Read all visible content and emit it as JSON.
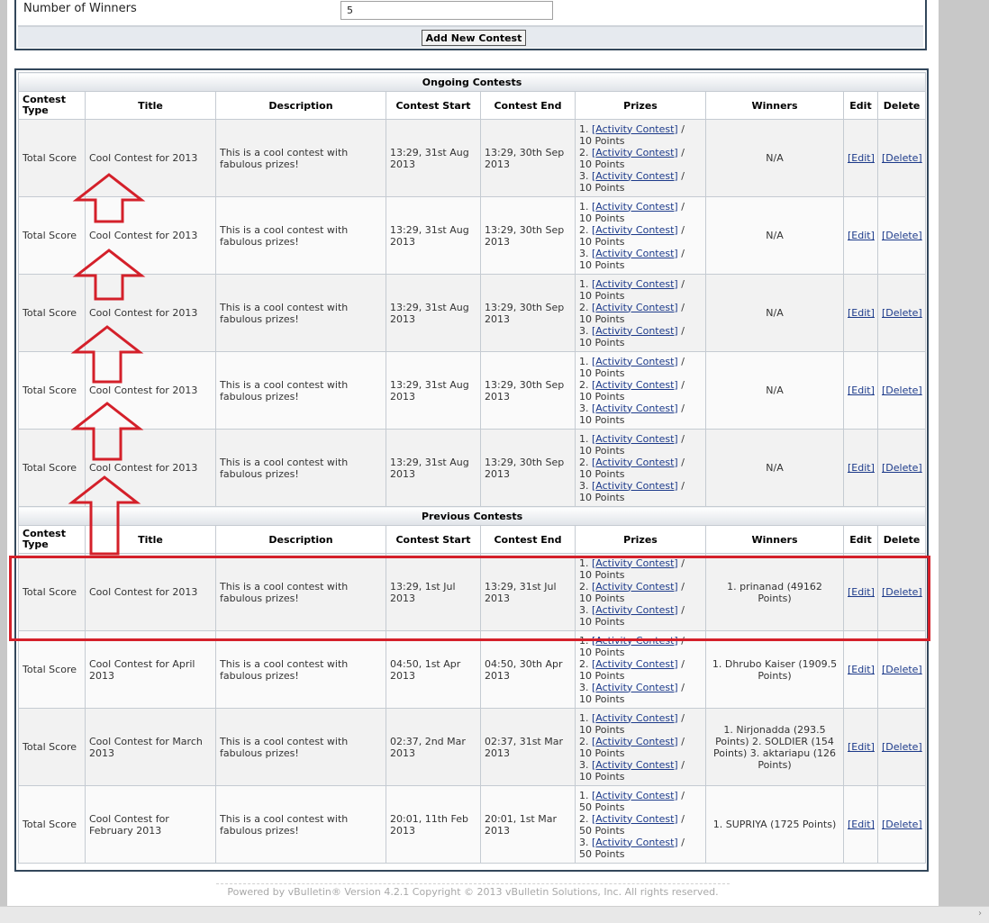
{
  "form": {
    "winners_label": "Number of Winners",
    "winners_value": "5",
    "add_button": "Add New Contest"
  },
  "sections": {
    "ongoing": "Ongoing Contests",
    "previous": "Previous Contests"
  },
  "columns": {
    "type": "Contest Type",
    "title": "Title",
    "description": "Description",
    "start": "Contest Start",
    "end": "Contest End",
    "prizes": "Prizes",
    "winners": "Winners",
    "edit": "Edit",
    "delete": "Delete"
  },
  "actions": {
    "edit": "[Edit]",
    "delete": "[Delete]"
  },
  "ongoing": [
    {
      "type": "Total Score",
      "title": "Cool Contest for 2013",
      "description": "This is a cool contest with fabulous prizes!",
      "start": "13:29, 31st Aug 2013",
      "end": "13:29, 30th Sep 2013",
      "winners": "N/A",
      "prizes": [
        {
          "n": "1.",
          "link": "[Activity Contest]",
          "pts": "10 Points"
        },
        {
          "n": "2.",
          "link": "[Activity Contest]",
          "pts": "10 Points"
        },
        {
          "n": "3.",
          "link": "[Activity Contest]",
          "pts": "10 Points"
        }
      ]
    },
    {
      "type": "Total Score",
      "title": "Cool Contest for 2013",
      "description": "This is a cool contest with fabulous prizes!",
      "start": "13:29, 31st Aug 2013",
      "end": "13:29, 30th Sep 2013",
      "winners": "N/A",
      "prizes": [
        {
          "n": "1.",
          "link": "[Activity Contest]",
          "pts": "10 Points"
        },
        {
          "n": "2.",
          "link": "[Activity Contest]",
          "pts": "10 Points"
        },
        {
          "n": "3.",
          "link": "[Activity Contest]",
          "pts": "10 Points"
        }
      ]
    },
    {
      "type": "Total Score",
      "title": "Cool Contest for 2013",
      "description": "This is a cool contest with fabulous prizes!",
      "start": "13:29, 31st Aug 2013",
      "end": "13:29, 30th Sep 2013",
      "winners": "N/A",
      "prizes": [
        {
          "n": "1.",
          "link": "[Activity Contest]",
          "pts": "10 Points"
        },
        {
          "n": "2.",
          "link": "[Activity Contest]",
          "pts": "10 Points"
        },
        {
          "n": "3.",
          "link": "[Activity Contest]",
          "pts": "10 Points"
        }
      ]
    },
    {
      "type": "Total Score",
      "title": "Cool Contest for 2013",
      "description": "This is a cool contest with fabulous prizes!",
      "start": "13:29, 31st Aug 2013",
      "end": "13:29, 30th Sep 2013",
      "winners": "N/A",
      "prizes": [
        {
          "n": "1.",
          "link": "[Activity Contest]",
          "pts": "10 Points"
        },
        {
          "n": "2.",
          "link": "[Activity Contest]",
          "pts": "10 Points"
        },
        {
          "n": "3.",
          "link": "[Activity Contest]",
          "pts": "10 Points"
        }
      ]
    },
    {
      "type": "Total Score",
      "title": "Cool Contest for 2013",
      "description": "This is a cool contest with fabulous prizes!",
      "start": "13:29, 31st Aug 2013",
      "end": "13:29, 30th Sep 2013",
      "winners": "N/A",
      "prizes": [
        {
          "n": "1.",
          "link": "[Activity Contest]",
          "pts": "10 Points"
        },
        {
          "n": "2.",
          "link": "[Activity Contest]",
          "pts": "10 Points"
        },
        {
          "n": "3.",
          "link": "[Activity Contest]",
          "pts": "10 Points"
        }
      ]
    }
  ],
  "previous": [
    {
      "type": "Total Score",
      "title": "Cool Contest for 2013",
      "description": "This is a cool contest with fabulous prizes!",
      "start": "13:29, 1st Jul 2013",
      "end": "13:29, 31st Jul 2013",
      "winners": "1. prinanad (49162 Points)",
      "prizes": [
        {
          "n": "1.",
          "link": "[Activity Contest]",
          "pts": "10 Points"
        },
        {
          "n": "2.",
          "link": "[Activity Contest]",
          "pts": "10 Points"
        },
        {
          "n": "3.",
          "link": "[Activity Contest]",
          "pts": "10 Points"
        }
      ]
    },
    {
      "type": "Total Score",
      "title": "Cool Contest for April 2013",
      "description": "This is a cool contest with fabulous prizes!",
      "start": "04:50, 1st Apr 2013",
      "end": "04:50, 30th Apr 2013",
      "winners": "1. Dhrubo Kaiser (1909.5 Points)",
      "prizes": [
        {
          "n": "1.",
          "link": "[Activity Contest]",
          "pts": "10 Points"
        },
        {
          "n": "2.",
          "link": "[Activity Contest]",
          "pts": "10 Points"
        },
        {
          "n": "3.",
          "link": "[Activity Contest]",
          "pts": "10 Points"
        }
      ]
    },
    {
      "type": "Total Score",
      "title": "Cool Contest for March 2013",
      "description": "This is a cool contest with fabulous prizes!",
      "start": "02:37, 2nd Mar 2013",
      "end": "02:37, 31st Mar 2013",
      "winners": "1. Nirjonadda (293.5 Points) 2. SOLDIER (154 Points) 3. aktariapu (126 Points)",
      "prizes": [
        {
          "n": "1.",
          "link": "[Activity Contest]",
          "pts": "10 Points"
        },
        {
          "n": "2.",
          "link": "[Activity Contest]",
          "pts": "10 Points"
        },
        {
          "n": "3.",
          "link": "[Activity Contest]",
          "pts": "10 Points"
        }
      ]
    },
    {
      "type": "Total Score",
      "title": "Cool Contest for February 2013",
      "description": "This is a cool contest with fabulous prizes!",
      "start": "20:01, 11th Feb 2013",
      "end": "20:01, 1st Mar 2013",
      "winners": "1. SUPRIYA (1725 Points)",
      "prizes": [
        {
          "n": "1.",
          "link": "[Activity Contest]",
          "pts": "50 Points"
        },
        {
          "n": "2.",
          "link": "[Activity Contest]",
          "pts": "50 Points"
        },
        {
          "n": "3.",
          "link": "[Activity Contest]",
          "pts": "50 Points"
        }
      ]
    }
  ],
  "footer": "Powered by vBulletin® Version 4.2.1 Copyright © 2013 vBulletin Solutions, Inc. All rights reserved.",
  "annotation_color": "#d4202a"
}
